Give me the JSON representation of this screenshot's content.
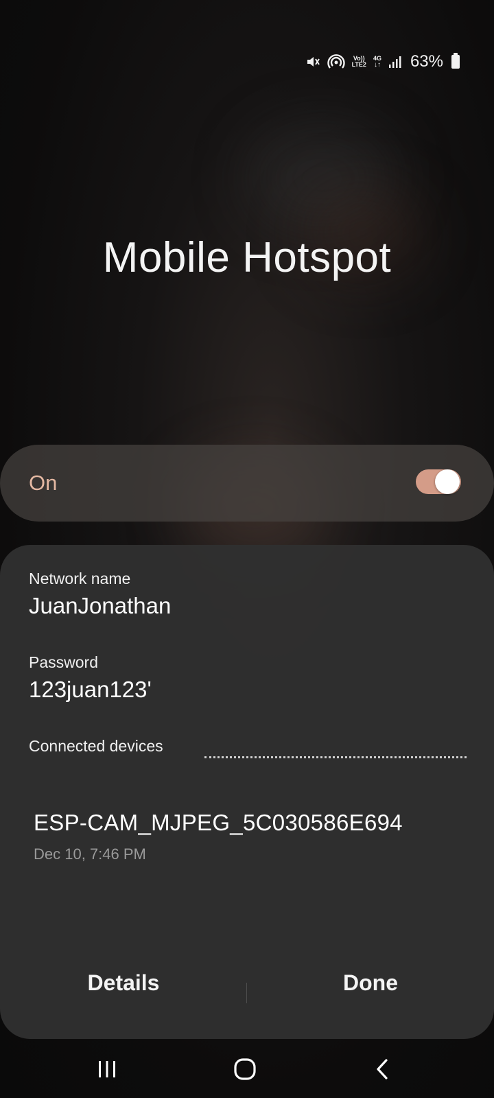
{
  "status_bar": {
    "volte_label_top": "Vo))",
    "volte_label_bottom": "LTE2",
    "network_type": "4G",
    "battery_percent": "63%",
    "icons": [
      "mute-icon",
      "hotspot-icon",
      "volte-icon",
      "data-arrows-icon",
      "signal-icon",
      "battery-icon"
    ]
  },
  "page": {
    "title": "Mobile Hotspot"
  },
  "toggle_bar": {
    "label": "On",
    "enabled": true,
    "accent_color": "#d49c88",
    "label_color": "#e4b8a2"
  },
  "network": {
    "name_label": "Network name",
    "name_value": "JuanJonathan",
    "password_label": "Password",
    "password_value": "123juan123'"
  },
  "connected_devices": {
    "label": "Connected devices",
    "devices": [
      {
        "name": "ESP-CAM_MJPEG_5C030586E694",
        "time": "Dec 10, 7:46 PM"
      }
    ]
  },
  "actions": {
    "details_label": "Details",
    "done_label": "Done"
  },
  "nav_bar": {
    "icons": [
      "recent-apps-icon",
      "home-icon",
      "back-icon"
    ]
  }
}
